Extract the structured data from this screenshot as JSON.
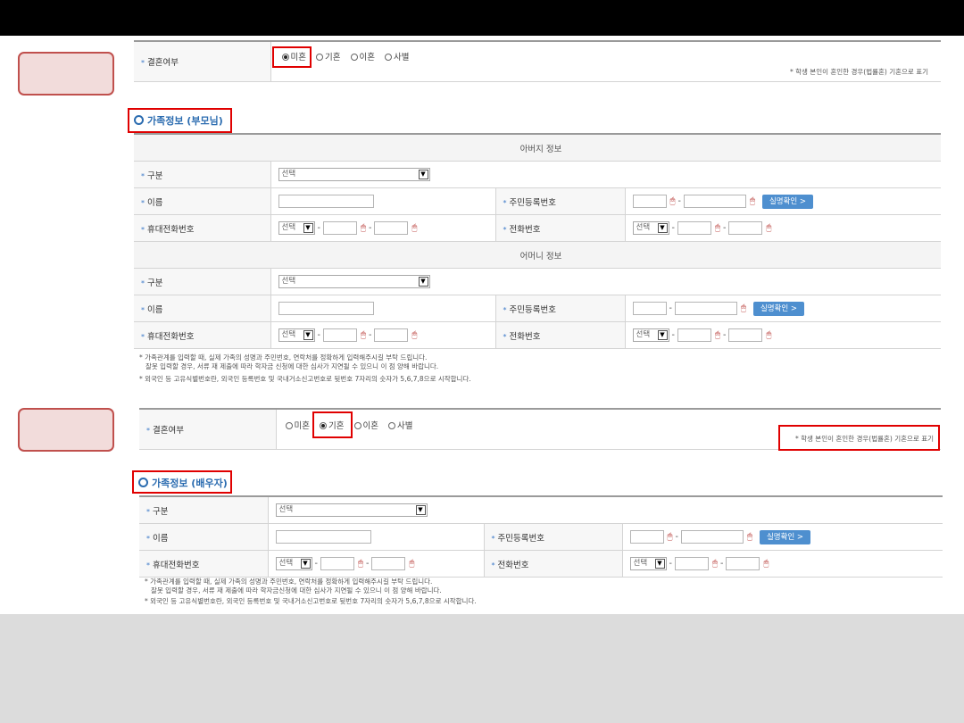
{
  "marriage1": {
    "label": "결혼여부",
    "options": [
      "미혼",
      "기혼",
      "이혼",
      "사별"
    ],
    "selected": 0,
    "note": "* 학생 본인이 혼인한 경우(법률혼) 기혼으로 표기"
  },
  "parents": {
    "title": "가족정보 (부모님)",
    "father_header": "아버지 정보",
    "mother_header": "어머니 정보",
    "labels": {
      "relation": "구분",
      "name": "이름",
      "resident_no": "주민등록번호",
      "mobile": "휴대전화번호",
      "phone": "전화번호"
    },
    "select_placeholder": "선택",
    "verify_button": "실명확인 >",
    "notes": [
      "* 가족관계를 입력할 때, 실제 가족의 성명과 주민번호, 연락처를 정확하게 입력해주시길 부탁 드립니다.",
      "잘못 입력할 경우, 서류 재 제출에 따라 학자금 신청에 대한 심사가 지연될 수 있으니 이 점 양해 바랍니다.",
      "* 외국인 등 고유식별번호란, 외국인 등록번호 및 국내거소신고번호로 뒷번호 7자리의 숫자가 5,6,7,8으로 시작합니다."
    ]
  },
  "marriage2": {
    "label": "결혼여부",
    "options": [
      "미혼",
      "기혼",
      "이혼",
      "사별"
    ],
    "selected": 1,
    "note": "* 학생 본인이 혼인한 경우(법률혼) 기혼으로 표기"
  },
  "spouse": {
    "title": "가족정보 (배우자)",
    "labels": {
      "relation": "구분",
      "name": "이름",
      "resident_no": "주민등록번호",
      "mobile": "휴대전화번호",
      "phone": "전화번호"
    },
    "select_placeholder": "선택",
    "verify_button": "실명확인 >",
    "notes": [
      "* 가족관계를 입력할 때, 실제 가족의 성명과 주민번호, 연락처를 정확하게 입력해주시길 부탁 드립니다.",
      "잘못 입력할 경우, 서류 재 제출에 따라 학자금신청에 대한 심사가 지연될 수 있으니 이 점 양해 바랍니다.",
      "* 외국인 등 고유식별번호란, 외국인 등록번호 및 국내거소신고번호로 뒷번호 7자리의 숫자가 5,6,7,8으로 시작합니다."
    ]
  },
  "colors": {
    "accent": "#2b6cb0",
    "highlight": "#e00000",
    "button": "#4e8fcf",
    "callout_fill": "#f2dcdb",
    "callout_border": "#c0504d"
  },
  "icons": [
    "mouse-pointer-icon",
    "chevron-down-icon",
    "radio-icon"
  ]
}
